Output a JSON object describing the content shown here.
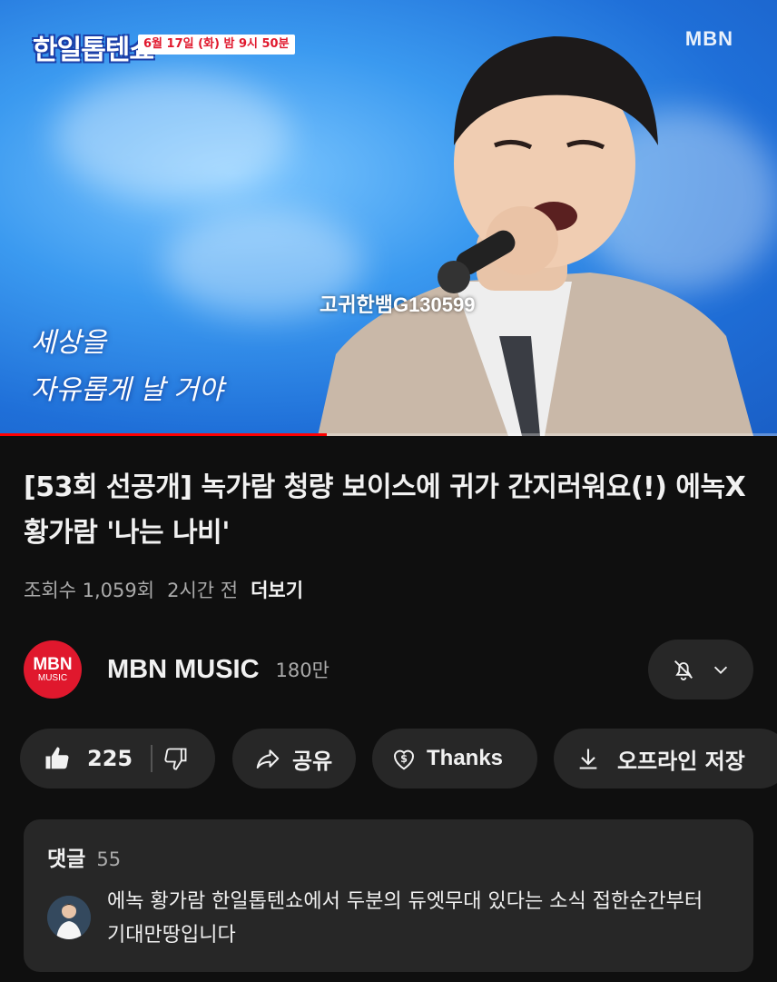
{
  "video": {
    "show_logo": "한일톱텐쇼",
    "air_badge": "6월 17일 (화) 밤 9시 50분",
    "channel_watermark": "MBN",
    "overlay_text": "고귀한뱀G130599",
    "lyric_line1": "세상을",
    "lyric_line2": "자유롭게 날 거야",
    "progress": 0.42
  },
  "title": "[53회 선공개] 녹가람 청량 보이스에 귀가 간지러워요(!) 에녹X황가람 '나는 나비'",
  "meta": {
    "views": "조회수 1,059회",
    "time": "2시간 전",
    "more": "더보기"
  },
  "channel": {
    "avatar_line1": "MBN",
    "avatar_line2": "MUSIC",
    "name": "MBN MUSIC",
    "subscribers": "180만"
  },
  "actions": {
    "likes": "225",
    "share": "공유",
    "thanks": "Thanks",
    "offline": "오프라인 저장"
  },
  "comments": {
    "label": "댓글",
    "count": "55",
    "top_comment": "에녹 황가람 한일톱텐쇼에서 두분의 듀엣무대 있다는 소식 접한순간부터 기대만땅입니다"
  },
  "colors": {
    "background": "#0f0f0f",
    "surface": "#272727",
    "brand_red": "#e0182d",
    "progress_red": "#ff0000",
    "muted_text": "#aaaaaa"
  },
  "icons": [
    "bell-off-icon",
    "chevron-down-icon",
    "thumbs-up-icon",
    "thumbs-down-icon",
    "share-arrow-icon",
    "heart-dollar-icon",
    "download-icon"
  ]
}
